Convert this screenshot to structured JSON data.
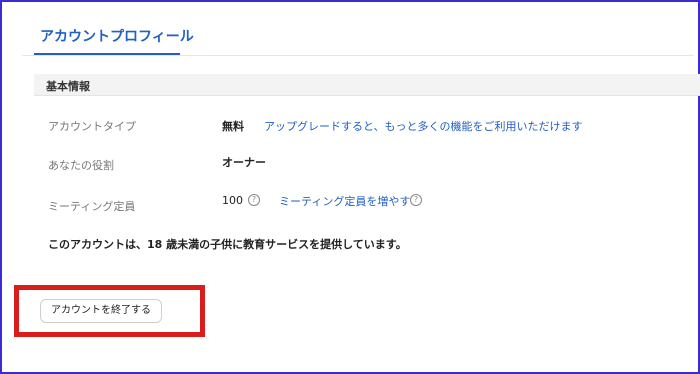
{
  "tabs": {
    "active": "アカウントプロフィール"
  },
  "section": {
    "title": "基本情報"
  },
  "rows": {
    "account_type": {
      "label": "アカウントタイプ",
      "value": "無料",
      "link": "アップグレードすると、もっと多くの機能をご利用いただけます"
    },
    "role": {
      "label": "あなたの役割",
      "value": "オーナー"
    },
    "capacity": {
      "label": "ミーティング定員",
      "value": "100",
      "link": "ミーティング定員を増やす"
    }
  },
  "notice": "このアカウントは、18 歳未満の子供に教育サービスを提供しています。",
  "buttons": {
    "end_account": "アカウントを終了する"
  },
  "icons": {
    "help": "?"
  },
  "colors": {
    "accent": "#1f5fc7",
    "highlight": "#d91c1c",
    "frame": "#3b2bd6"
  }
}
